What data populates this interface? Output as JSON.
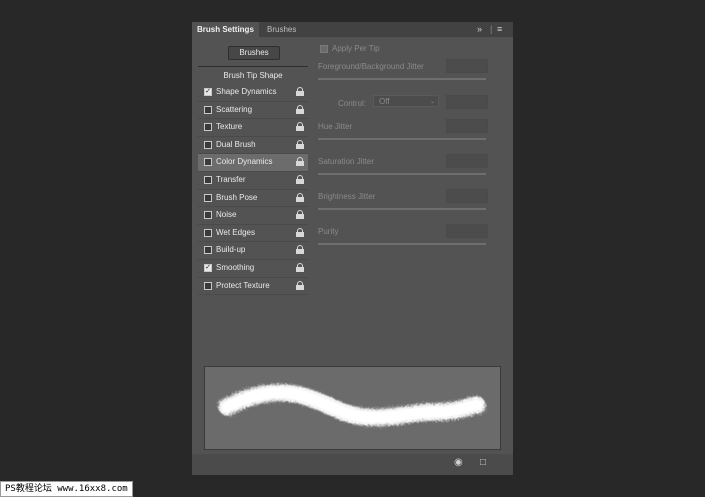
{
  "tabs": {
    "active": "Brush Settings",
    "inactive": "Brushes"
  },
  "tab_icons": [
    "expand-panel-icon",
    "panel-menu-icon"
  ],
  "brushes_button": "Brushes",
  "brush_tip_shape": "Brush Tip Shape",
  "items": [
    {
      "label": "Shape Dynamics",
      "checked": true
    },
    {
      "label": "Scattering",
      "checked": false
    },
    {
      "label": "Texture",
      "checked": false
    },
    {
      "label": "Dual Brush",
      "checked": false
    },
    {
      "label": "Color Dynamics",
      "checked": false,
      "selected": true
    },
    {
      "label": "Transfer",
      "checked": false
    },
    {
      "label": "Brush Pose",
      "checked": false
    },
    {
      "label": "Noise",
      "checked": false
    },
    {
      "label": "Wet Edges",
      "checked": false
    },
    {
      "label": "Build-up",
      "checked": false
    },
    {
      "label": "Smoothing",
      "checked": true
    },
    {
      "label": "Protect Texture",
      "checked": false
    }
  ],
  "settings": {
    "apply_per_tip": "Apply Per Tip",
    "fg_bg_jitter": "Foreground/Background Jitter",
    "control_label": "Control:",
    "control_value": "Off",
    "hue_jitter": "Hue Jitter",
    "saturation_jitter": "Saturation Jitter",
    "brightness_jitter": "Brightness Jitter",
    "purity": "Purity"
  },
  "bottom_icons": [
    "toggle-preview-icon",
    "new-brush-icon"
  ],
  "watermark": "PS教程论坛 www.16xx8.com",
  "colors": {
    "background": "#282828",
    "panel": "#535353",
    "selected_row": "#6c6c6c"
  }
}
